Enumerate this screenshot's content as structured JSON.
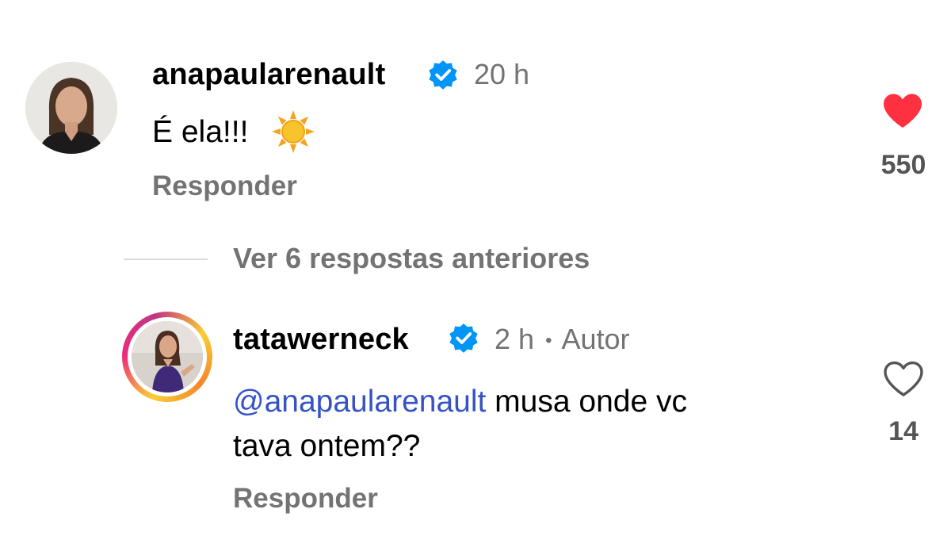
{
  "comments": [
    {
      "username": "anapaularenault",
      "time": "20 h",
      "text": "É ela!!!",
      "emoji": "☀️",
      "reply_label": "Responder",
      "like_count": "550",
      "liked": true,
      "verified": true,
      "avatar": "avatar-woman-dark-hair"
    },
    {
      "username": "tatawerneck",
      "time": "2 h",
      "separator": "•",
      "author_label": "Autor",
      "mention": "@anapaularenault",
      "text_line1": " musa onde vc",
      "text_line2": "tava ontem??",
      "reply_label": "Responder",
      "like_count": "14",
      "liked": false,
      "verified": true,
      "avatar": "avatar-story-ring"
    }
  ],
  "view_replies_label": "Ver 6 respostas anteriores",
  "colors": {
    "like_red": "#ff3040",
    "verified_blue": "#0095f6",
    "secondary_text": "#737373",
    "mention_blue": "#3553c7"
  }
}
